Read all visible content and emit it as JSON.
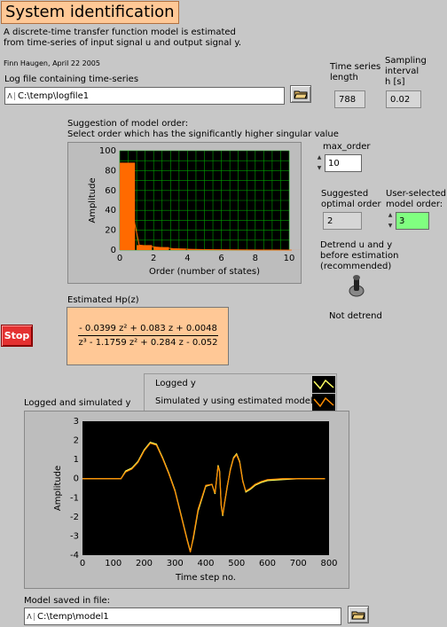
{
  "header": {
    "title": "System identification",
    "description_line1": "A discrete-time transfer function model is estimated",
    "description_line2": "from time-series of input signal u and output signal y.",
    "author": "Finn Haugen, April 22 2005"
  },
  "logfile": {
    "label": "Log file containing time-series",
    "path_prefix": "ⴷ",
    "path": "C:\\temp\\logfile1"
  },
  "series_length": {
    "label_line1": "Time series",
    "label_line2": "length",
    "value": "788"
  },
  "sampling": {
    "label_line1": "Sampling",
    "label_line2": "interval",
    "label_line3": "h [s]",
    "value": "0.02"
  },
  "order_chart_caption": {
    "line1": "Suggestion of model order:",
    "line2": "Select order which has the significantly higher singular value"
  },
  "max_order": {
    "label": "max_order",
    "value": "10"
  },
  "suggested": {
    "label_line1": "Suggested",
    "label_line2": "optimal order",
    "value": "2"
  },
  "user_order": {
    "label_line1": "User-selected",
    "label_line2": "model order:",
    "value": "3"
  },
  "detrend": {
    "label_line1": "Detrend u and y",
    "label_line2": "before estimation",
    "label_line3": "(recommended)",
    "status": "Not detrend"
  },
  "stop_button": {
    "label": "Stop"
  },
  "hp": {
    "label": "Estimated Hp(z)",
    "numerator": "- 0.0399 z² + 0.083 z + 0.0048",
    "denominator": "z³ - 1.1759 z² + 0.284 z - 0.052"
  },
  "sim_caption": "Logged and simulated y",
  "legend": {
    "logged": "Logged y",
    "simulated": "Simulated y using estimated model"
  },
  "model_file": {
    "label": "Model saved in file:",
    "path_prefix": "ⴷ",
    "path": "C:\\temp\\model1"
  },
  "colors": {
    "accent": "#ffc896",
    "plot_bg": "#000000",
    "grid": "#00a000",
    "bar": "#ff6a00",
    "logged_line": "#ffff60",
    "sim_line": "#ff8c00",
    "stop": "#e43030",
    "user_order_bg": "#80ff80"
  },
  "chart_data": [
    {
      "type": "bar",
      "title": "",
      "xlabel": "Order (number of states)",
      "ylabel": "Amplitude",
      "x": [
        0,
        1,
        2,
        3,
        4,
        5,
        6,
        7,
        8,
        9,
        10
      ],
      "values": [
        88,
        5,
        3,
        1.5,
        0.8,
        0.4,
        0.3,
        0.2,
        0.1,
        0.1,
        0.05
      ],
      "xlim": [
        0,
        10
      ],
      "ylim": [
        0,
        100
      ],
      "xticks": [
        0,
        2,
        4,
        6,
        8,
        10
      ],
      "yticks": [
        0,
        20,
        40,
        60,
        80,
        100
      ],
      "grid": true
    },
    {
      "type": "line",
      "xlabel": "Time step no.",
      "ylabel": "Amplitude",
      "xlim": [
        0,
        800
      ],
      "ylim": [
        -4,
        3
      ],
      "xticks": [
        0,
        100,
        200,
        300,
        400,
        500,
        600,
        700,
        800
      ],
      "yticks": [
        -4,
        -3,
        -2,
        -1,
        0,
        1,
        2,
        3
      ],
      "grid": false,
      "series": [
        {
          "name": "Logged y",
          "x": [
            0,
            50,
            125,
            140,
            160,
            180,
            200,
            220,
            240,
            260,
            280,
            300,
            320,
            340,
            350,
            360,
            375,
            400,
            420,
            430,
            440,
            445,
            450,
            455,
            460,
            470,
            480,
            490,
            500,
            510,
            520,
            530,
            545,
            560,
            580,
            600,
            650,
            700,
            787
          ],
          "values": [
            0,
            0,
            0,
            0.4,
            0.55,
            0.9,
            1.5,
            1.9,
            1.8,
            1.1,
            0.3,
            -0.6,
            -1.9,
            -3.2,
            -3.8,
            -3.1,
            -1.7,
            -0.4,
            -0.3,
            -0.8,
            0.7,
            0.4,
            -1.4,
            -1.95,
            -1.4,
            -0.4,
            0.5,
            1.1,
            1.3,
            0.9,
            -0.1,
            -0.7,
            -0.55,
            -0.35,
            -0.2,
            -0.1,
            -0.05,
            0,
            0
          ]
        },
        {
          "name": "Simulated y using estimated model",
          "x": [
            0,
            50,
            125,
            140,
            160,
            180,
            200,
            220,
            240,
            260,
            280,
            300,
            320,
            340,
            350,
            360,
            375,
            400,
            420,
            430,
            440,
            445,
            450,
            455,
            460,
            470,
            480,
            490,
            500,
            510,
            520,
            530,
            545,
            560,
            580,
            600,
            650,
            700,
            787
          ],
          "values": [
            0,
            0,
            0,
            0.35,
            0.5,
            0.85,
            1.45,
            1.85,
            1.75,
            1.05,
            0.25,
            -0.65,
            -1.95,
            -3.25,
            -3.85,
            -3.0,
            -1.6,
            -0.35,
            -0.3,
            -0.75,
            0.65,
            0.35,
            -1.35,
            -1.9,
            -1.35,
            -0.35,
            0.45,
            1.05,
            1.25,
            0.85,
            -0.15,
            -0.65,
            -0.5,
            -0.3,
            -0.15,
            -0.05,
            0,
            0,
            0
          ]
        }
      ]
    }
  ]
}
